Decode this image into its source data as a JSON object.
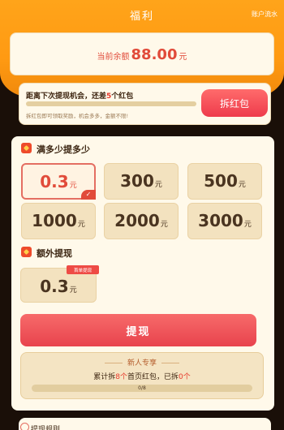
{
  "header": {
    "title": "福利",
    "right_link": "账户流水"
  },
  "balance": {
    "label": "当前余额",
    "amount": "88.00",
    "unit": "元"
  },
  "chance": {
    "text_prefix": "距离下次提现机会，还差",
    "count": "5",
    "text_suffix": "个红包",
    "sub_text": "拆红包即可领取奖励，机会多多，金额不限!",
    "progress": 0.0,
    "button_label": "拆红包"
  },
  "section1": {
    "title": "满多少提多少",
    "options": [
      {
        "value": "0.3",
        "unit": "元",
        "selected": true
      },
      {
        "value": "300",
        "unit": "元"
      },
      {
        "value": "500",
        "unit": "元"
      },
      {
        "value": "1000",
        "unit": "元"
      },
      {
        "value": "2000",
        "unit": "元"
      },
      {
        "value": "3000",
        "unit": "元"
      }
    ]
  },
  "section2": {
    "title": "额外提现",
    "tag": "首单提现",
    "option": {
      "value": "0.3",
      "unit": "元"
    }
  },
  "withdraw_button": "提现",
  "newbie": {
    "title": "新人专享",
    "text_a": "累计拆",
    "target": "8个",
    "text_b": "首页红包，已拆",
    "done": "0个",
    "progress_label": "0/8"
  },
  "bottom": {
    "label": "提现规则"
  },
  "colors": {
    "accent": "#ffa41a",
    "red": "#e14b3a",
    "card": "#fff9ea"
  }
}
